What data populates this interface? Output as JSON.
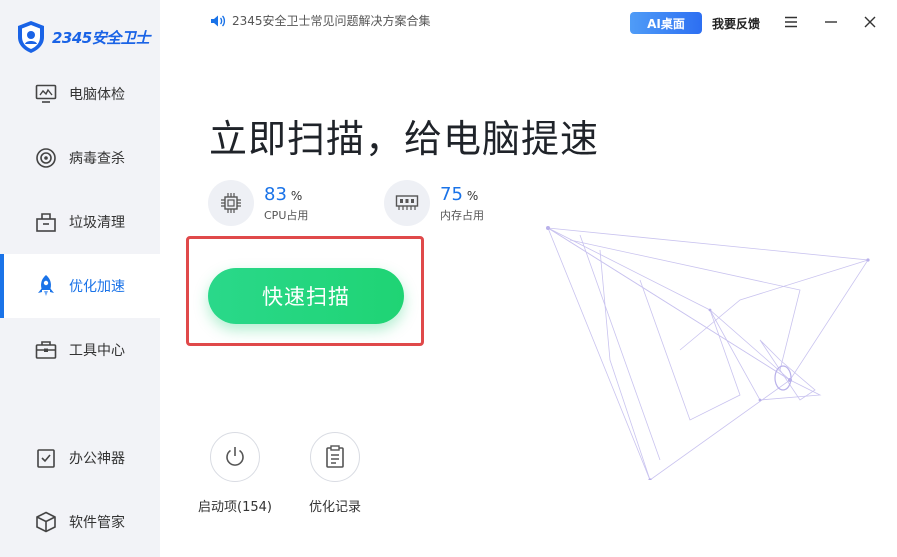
{
  "app": {
    "logo_text": "2345安全卫士"
  },
  "topbar": {
    "notice": "2345安全卫士常见问题解决方案合集",
    "ai_button": "AI桌面",
    "feedback": "我要反馈"
  },
  "sidebar": {
    "items": [
      {
        "label": "电脑体检",
        "icon": "monitor-icon"
      },
      {
        "label": "病毒查杀",
        "icon": "target-icon"
      },
      {
        "label": "垃圾清理",
        "icon": "trash-box-icon"
      },
      {
        "label": "优化加速",
        "icon": "rocket-icon",
        "active": true
      },
      {
        "label": "工具中心",
        "icon": "toolbox-icon"
      }
    ],
    "bottom_items": [
      {
        "label": "办公神器",
        "icon": "clipboard-check-icon"
      },
      {
        "label": "软件管家",
        "icon": "cube-icon"
      }
    ]
  },
  "main": {
    "headline": "立即扫描，给电脑提速",
    "stats": [
      {
        "value": "83",
        "unit": "%",
        "label": "CPU占用",
        "icon": "cpu-icon"
      },
      {
        "value": "75",
        "unit": "%",
        "label": "内存占用",
        "icon": "memory-icon"
      }
    ],
    "scan_button": "快速扫描",
    "quick_actions": [
      {
        "label": "启动项(154)",
        "icon": "power-icon"
      },
      {
        "label": "优化记录",
        "icon": "record-list-icon"
      }
    ]
  },
  "colors": {
    "accent": "#1a73e8",
    "scan_green": "#22d57c",
    "highlight_red": "#e0494a"
  }
}
